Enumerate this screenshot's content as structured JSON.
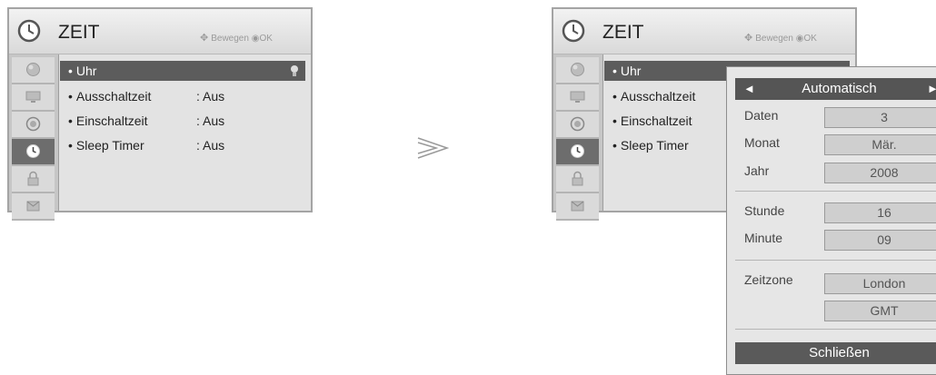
{
  "left_menu": {
    "title": "ZEIT",
    "hint_move": "Bewegen",
    "hint_ok": "OK",
    "items": [
      {
        "label": "Uhr",
        "value": ""
      },
      {
        "label": "Ausschaltzeit",
        "value": ": Aus"
      },
      {
        "label": "Einschaltzeit",
        "value": ": Aus"
      },
      {
        "label": "Sleep Timer",
        "value": ": Aus"
      }
    ],
    "sidebar_icons": [
      "picture-icon",
      "screen-icon",
      "audio-icon",
      "time-icon",
      "lock-icon",
      "option-icon"
    ]
  },
  "right_menu": {
    "title": "ZEIT",
    "hint_move": "Bewegen",
    "hint_ok": "OK",
    "items": [
      {
        "label": "Uhr"
      },
      {
        "label": "Ausschaltzeit"
      },
      {
        "label": "Einschaltzeit"
      },
      {
        "label": "Sleep Timer"
      }
    ]
  },
  "separator_symbol": "≫",
  "popup": {
    "mode": "Automatisch",
    "fields": {
      "daten_label": "Daten",
      "daten_value": "3",
      "monat_label": "Monat",
      "monat_value": "Mär.",
      "jahr_label": "Jahr",
      "jahr_value": "2008",
      "stunde_label": "Stunde",
      "stunde_value": "16",
      "minute_label": "Minute",
      "minute_value": "09",
      "zeitzone_label": "Zeitzone",
      "zeitzone_value": "London",
      "gmt_value": "GMT"
    },
    "close_label": "Schließen"
  }
}
